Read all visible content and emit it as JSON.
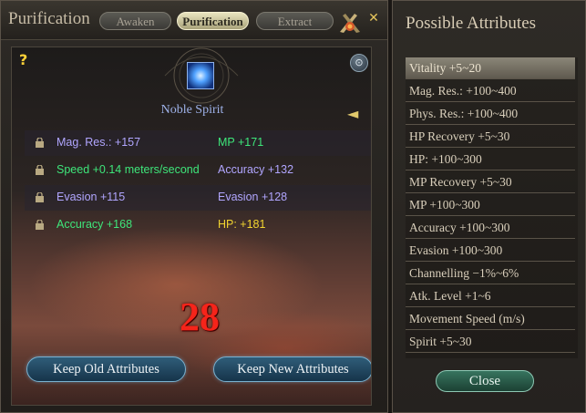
{
  "main_window": {
    "title": "Purification",
    "tabs": [
      {
        "label": "Awaken",
        "active": false
      },
      {
        "label": "Purification",
        "active": true
      },
      {
        "label": "Extract",
        "active": false
      }
    ],
    "close_glyph": "✕",
    "help_glyph": "?",
    "item": {
      "name": "Noble Spirit",
      "icon": "blue-spirit-icon"
    },
    "attributes": [
      {
        "old": "Mag. Res.: +157",
        "old_color": "#b1a6ff",
        "new": "MP +171",
        "new_color": "#3ee67a"
      },
      {
        "old": "Speed +0.14 meters/second",
        "old_color": "#3ee67a",
        "new": "Accuracy +132",
        "new_color": "#b1a6ff"
      },
      {
        "old": "Evasion +115",
        "old_color": "#b1a6ff",
        "new": "Evasion +128",
        "new_color": "#b1a6ff"
      },
      {
        "old": "Accuracy +168",
        "old_color": "#3ee67a",
        "new": "HP: +181",
        "new_color": "#f2d530"
      }
    ],
    "remaining_count": "28",
    "keep_old_label": "Keep Old Attributes",
    "keep_new_label": "Keep New Attributes"
  },
  "side_window": {
    "title": "Possible Attributes",
    "items": [
      "Vitality +5~20",
      "Mag. Res.: +100~400",
      "Phys. Res.: +100~400",
      "HP Recovery +5~30",
      "HP: +100~300",
      "MP Recovery +5~30",
      "MP +100~300",
      "Accuracy +100~300",
      "Evasion +100~300",
      "Channelling −1%~6%",
      "Atk. Level +1~6",
      "Movement Speed (m/s)",
      "Spirit +5~30"
    ],
    "selected_index": 0,
    "close_label": "Close"
  },
  "colors": {
    "accent_gold": "#e5c55c",
    "count_red": "#f5241a",
    "button_blue": "#2f5d79",
    "button_green": "#37745f"
  }
}
